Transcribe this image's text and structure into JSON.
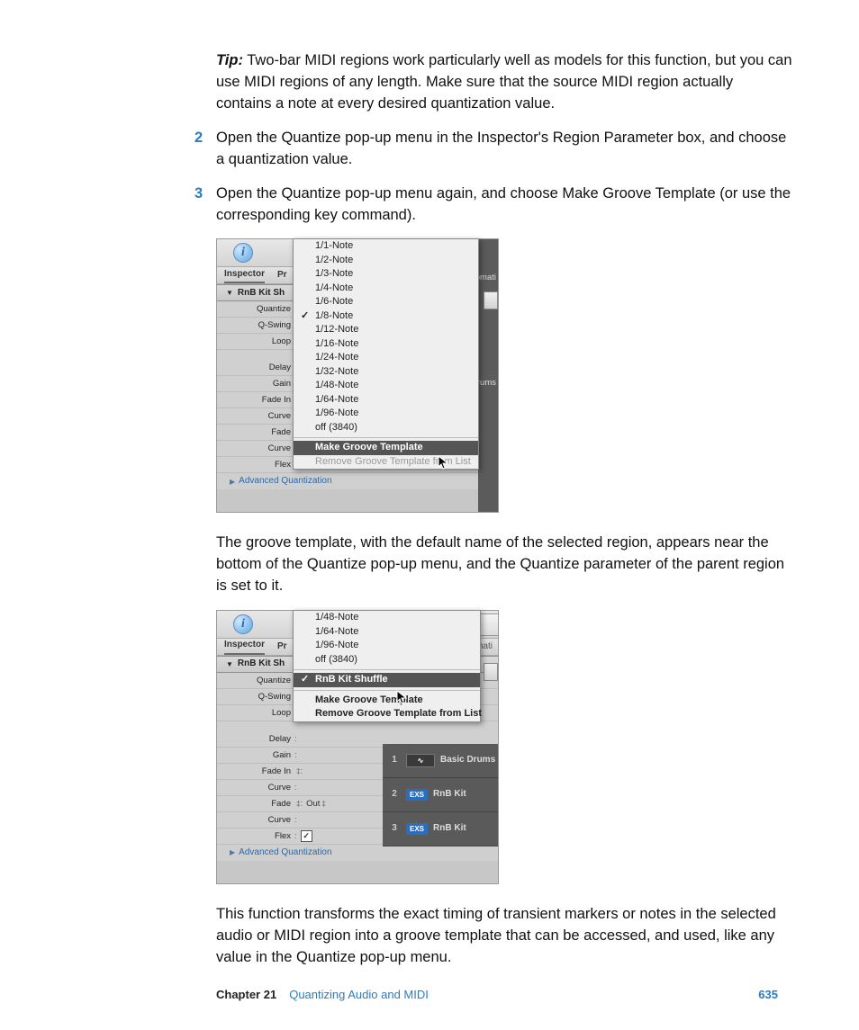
{
  "tip": {
    "label": "Tip:",
    "text": "Two-bar MIDI regions work particularly well as models for this function, but you can use MIDI regions of any length. Make sure that the source MIDI region actually contains a note at every desired quantization value."
  },
  "steps": {
    "s2": {
      "num": "2",
      "text": "Open the Quantize pop-up menu in the Inspector's Region Parameter box, and choose a quantization value."
    },
    "s3": {
      "num": "3",
      "text": "Open the Quantize pop-up menu again, and choose Make Groove Template (or use the corresponding key command)."
    }
  },
  "para1": "The groove template, with the default name of the selected region, appears near the bottom of the Quantize pop-up menu, and the Quantize parameter of the parent region is set to it.",
  "para2": "This function transforms the exact timing of transient markers or notes in the selected audio or MIDI region into a groove template that can be accessed, and used, like any value in the Quantize pop-up menu.",
  "inspector": {
    "tab1": "Inspector",
    "tab2": "Pr",
    "tab_right": "omati",
    "region_name": "RnB Kit Sh",
    "params": {
      "quantize": "Quantize",
      "qswing": "Q-Swing",
      "loop": "Loop",
      "delay": "Delay",
      "gain": "Gain",
      "fadein": "Fade In",
      "curve1": "Curve",
      "fade": "Fade",
      "curve2": "Curve",
      "flex": "Flex",
      "fade_out": "Out"
    },
    "advanced": "Advanced Quantization"
  },
  "popup1": {
    "items": {
      "i0": "1/1-Note",
      "i1": "1/2-Note",
      "i2": "1/3-Note",
      "i3": "1/4-Note",
      "i4": "1/6-Note",
      "i5": "1/8-Note",
      "i6": "1/12-Note",
      "i7": "1/16-Note",
      "i8": "1/24-Note",
      "i9": "1/32-Note",
      "i10": "1/48-Note",
      "i11": "1/64-Note",
      "i12": "1/96-Note",
      "i13": "off (3840)"
    },
    "make": "Make Groove Template",
    "remove": "Remove Groove Template from List"
  },
  "popup2": {
    "items": {
      "i0": "1/48-Note",
      "i1": "1/64-Note",
      "i2": "1/96-Note",
      "i3": "off (3840)"
    },
    "template": "RnB Kit Shuffle",
    "make": "Make Groove Template",
    "remove": "Remove Groove Template from List"
  },
  "tracks": {
    "t1": {
      "num": "1",
      "name": "Basic Drums"
    },
    "t2": {
      "num": "2",
      "badge": "EXS",
      "name": "RnB Kit"
    },
    "t3": {
      "num": "3",
      "badge": "EXS",
      "name": "RnB Kit"
    }
  },
  "right_partial": {
    "rums": "rums"
  },
  "footer": {
    "chapter": "Chapter 21",
    "title": "Quantizing Audio and MIDI",
    "page": "635"
  },
  "info_glyph": "i"
}
